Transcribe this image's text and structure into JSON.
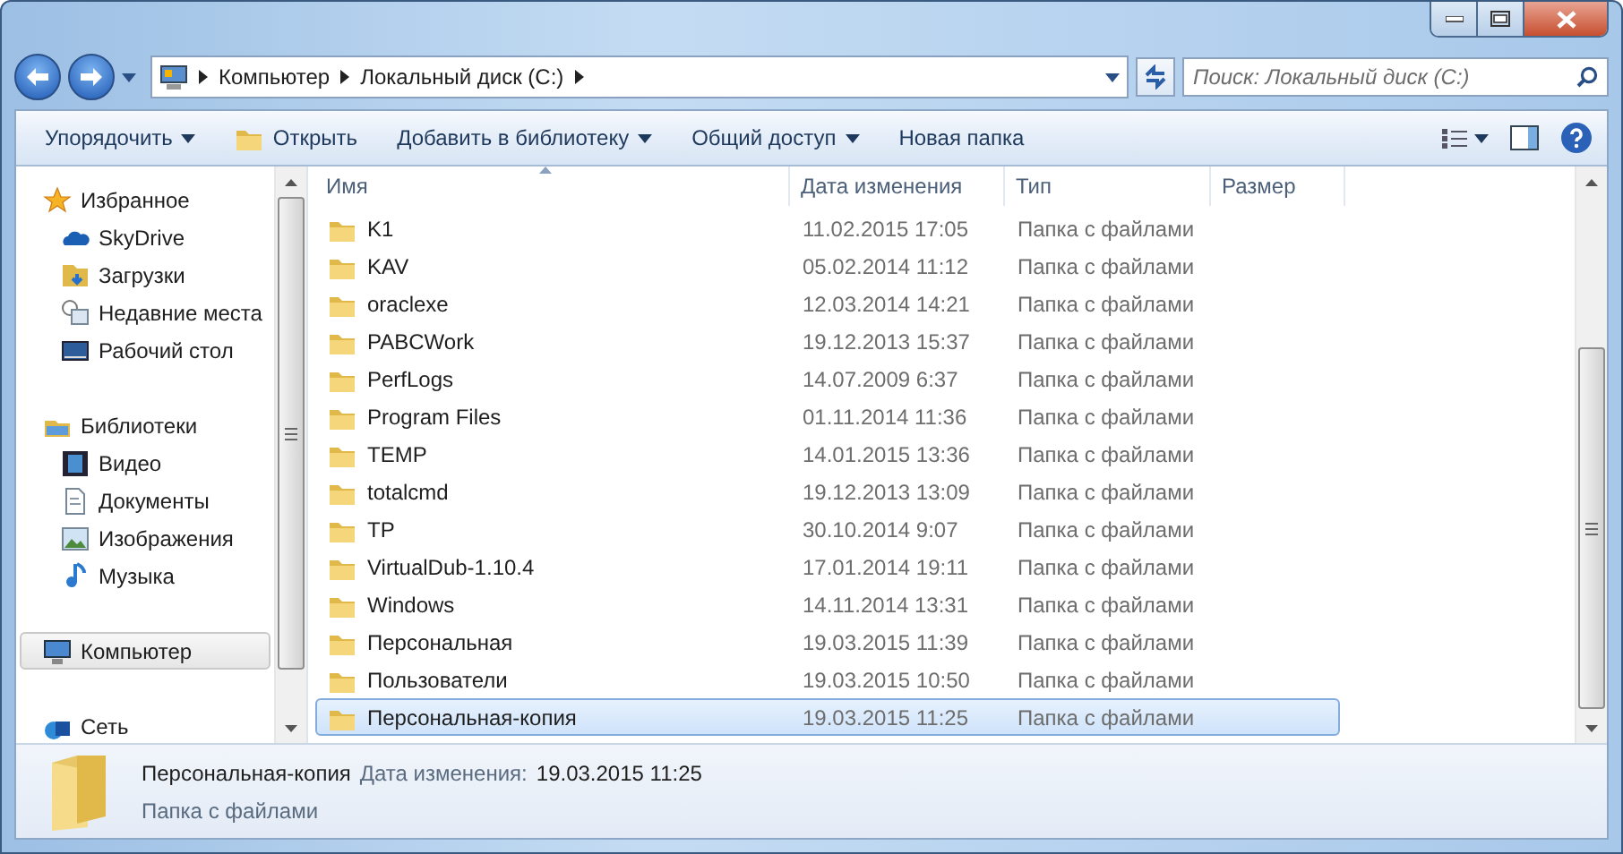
{
  "address": {
    "crumbs": [
      "Компьютер",
      "Локальный диск (C:)"
    ]
  },
  "search": {
    "placeholder": "Поиск: Локальный диск (C:)"
  },
  "toolbar": [
    {
      "label": "Упорядочить",
      "menu": true
    },
    {
      "label": "Открыть",
      "menu": false
    },
    {
      "label": "Добавить в библиотеку",
      "menu": true
    },
    {
      "label": "Общий доступ",
      "menu": true
    },
    {
      "label": "Новая папка",
      "menu": false
    }
  ],
  "sidebar": [
    {
      "label": "Избранное",
      "selected": false,
      "children": [
        {
          "label": "SkyDrive"
        },
        {
          "label": "Загрузки"
        },
        {
          "label": "Недавние места"
        },
        {
          "label": "Рабочий стол"
        }
      ]
    },
    {
      "label": "Библиотеки",
      "selected": false,
      "children": [
        {
          "label": "Видео"
        },
        {
          "label": "Документы"
        },
        {
          "label": "Изображения"
        },
        {
          "label": "Музыка"
        }
      ]
    },
    {
      "label": "Компьютер",
      "selected": true
    },
    {
      "label": "Сеть",
      "selected": false
    }
  ],
  "columns": [
    {
      "label": "Имя",
      "sorted": true
    },
    {
      "label": "Дата изменения",
      "sorted": false
    },
    {
      "label": "Тип",
      "sorted": false
    },
    {
      "label": "Размер",
      "sorted": false
    }
  ],
  "rows": [
    {
      "name": "K1",
      "date": "11.02.2015 17:05",
      "type": "Папка с файлами",
      "selected": false
    },
    {
      "name": "KAV",
      "date": "05.02.2014 11:12",
      "type": "Папка с файлами",
      "selected": false
    },
    {
      "name": "oraclexe",
      "date": "12.03.2014 14:21",
      "type": "Папка с файлами",
      "selected": false
    },
    {
      "name": "PABCWork",
      "date": "19.12.2013 15:37",
      "type": "Папка с файлами",
      "selected": false
    },
    {
      "name": "PerfLogs",
      "date": "14.07.2009 6:37",
      "type": "Папка с файлами",
      "selected": false
    },
    {
      "name": "Program Files",
      "date": "01.11.2014 11:36",
      "type": "Папка с файлами",
      "selected": false
    },
    {
      "name": "TEMP",
      "date": "14.01.2015 13:36",
      "type": "Папка с файлами",
      "selected": false
    },
    {
      "name": "totalcmd",
      "date": "19.12.2013 13:09",
      "type": "Папка с файлами",
      "selected": false
    },
    {
      "name": "TP",
      "date": "30.10.2014 9:07",
      "type": "Папка с файлами",
      "selected": false
    },
    {
      "name": "VirtualDub-1.10.4",
      "date": "17.01.2014 19:11",
      "type": "Папка с файлами",
      "selected": false
    },
    {
      "name": "Windows",
      "date": "14.11.2014 13:31",
      "type": "Папка с файлами",
      "selected": false
    },
    {
      "name": "Персональная",
      "date": "19.03.2015 11:39",
      "type": "Папка с файлами",
      "selected": false
    },
    {
      "name": "Пользователи",
      "date": "19.03.2015 10:50",
      "type": "Папка с файлами",
      "selected": false
    },
    {
      "name": "Персональная-копия",
      "date": "19.03.2015 11:25",
      "type": "Папка с файлами",
      "selected": true
    }
  ],
  "details": {
    "name": "Персональная-копия",
    "date_label": "Дата изменения:",
    "date": "19.03.2015 11:25",
    "type": "Папка с файлами"
  }
}
